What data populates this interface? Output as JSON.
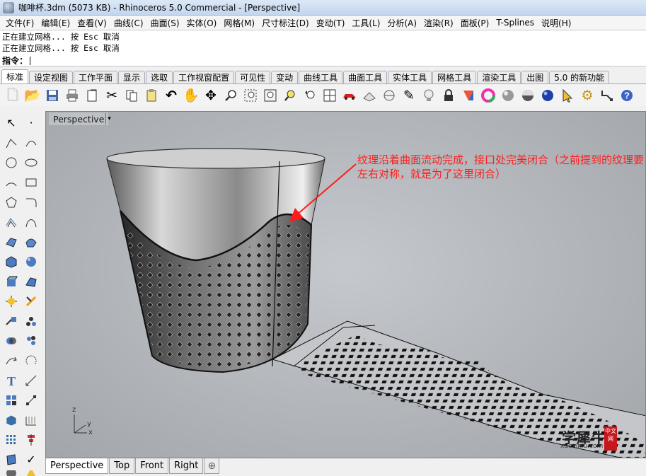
{
  "window": {
    "title": "咖啡杯.3dm (5073 KB) - Rhinoceros 5.0 Commercial - [Perspective]"
  },
  "menu": [
    "文件(F)",
    "编辑(E)",
    "查看(V)",
    "曲线(C)",
    "曲面(S)",
    "实体(O)",
    "网格(M)",
    "尺寸标注(D)",
    "变动(T)",
    "工具(L)",
    "分析(A)",
    "渲染(R)",
    "面板(P)",
    "T-Splines",
    "说明(H)"
  ],
  "command_history": [
    "正在建立网格... 按 Esc 取消",
    "正在建立网格... 按 Esc 取消"
  ],
  "command_prompt": "指令：",
  "toolbar_tabs": [
    "标准",
    "设定视图",
    "工作平面",
    "显示",
    "选取",
    "工作视窗配置",
    "可见性",
    "变动",
    "曲线工具",
    "曲面工具",
    "实体工具",
    "网格工具",
    "渲染工具",
    "出图",
    "5.0 的新功能"
  ],
  "active_toolbar_tab": "标准",
  "toolbar_icons": [
    "new-file-icon",
    "open-folder-icon",
    "save-icon",
    "print-icon",
    "import-icon",
    "cut-icon",
    "copy-icon",
    "paste-icon",
    "undo-icon",
    "pan-hand-icon",
    "rotate-view-icon",
    "zoom-dynamic-icon",
    "zoom-window-icon",
    "zoom-extents-icon",
    "zoom-selected-icon",
    "undo-view-icon",
    "four-viewports-icon",
    "car-render-icon",
    "grid-plane-icon",
    "mesh-preview-icon",
    "pen-tool-icon",
    "light-bulb-icon",
    "lock-icon",
    "color-swatch-icon",
    "color-wheel-icon",
    "sphere-material-icon",
    "sphere-shaded-icon",
    "sphere-blue-icon",
    "select-filter-icon",
    "options-gear-icon",
    "snap-icon",
    "help-icon"
  ],
  "sidebar_icons": [
    "select-arrow-icon",
    "point-icon",
    "polyline-icon",
    "curve-icon",
    "circle-icon",
    "ellipse-icon",
    "arc-icon",
    "rectangle-icon",
    "polygon-icon",
    "fillet-curve-icon",
    "offset-curve-icon",
    "freeform-curve-icon",
    "surface-corner-icon",
    "surface-patch-icon",
    "box-solid-icon",
    "sphere-solid-icon",
    "extrude-icon",
    "loft-icon",
    "explode-icon",
    "trim-icon",
    "split-icon",
    "join-icon",
    "boolean-union-icon",
    "group-icon",
    "move-icon",
    "rotate-icon",
    "text-icon",
    "dimension-icon",
    "block-icon",
    "edit-points-icon",
    "mesh-box-icon",
    "mesh-grid-icon",
    "array-icon",
    "align-icon",
    "shell-icon",
    "check-icon",
    "render-mesh-icon",
    "light-icon"
  ],
  "viewport": {
    "name": "Perspective",
    "annotation": "纹理沿着曲面流动完成，接口处完美闭合（之前提到的纹理要左右对称，就是为了这里闭合）",
    "axes": {
      "x": "x",
      "y": "y",
      "z": "z"
    },
    "watermark": {
      "main": "学犀牛",
      "url": "xuexiniu.com",
      "badge": "中文网"
    }
  },
  "view_tabs": [
    "Perspective",
    "Top",
    "Front",
    "Right"
  ],
  "active_view_tab": "Perspective",
  "colors": {
    "annotation": "#ff1c1c",
    "viewport_bg": "#b4b8bc",
    "accent": "#3a6ea5"
  }
}
